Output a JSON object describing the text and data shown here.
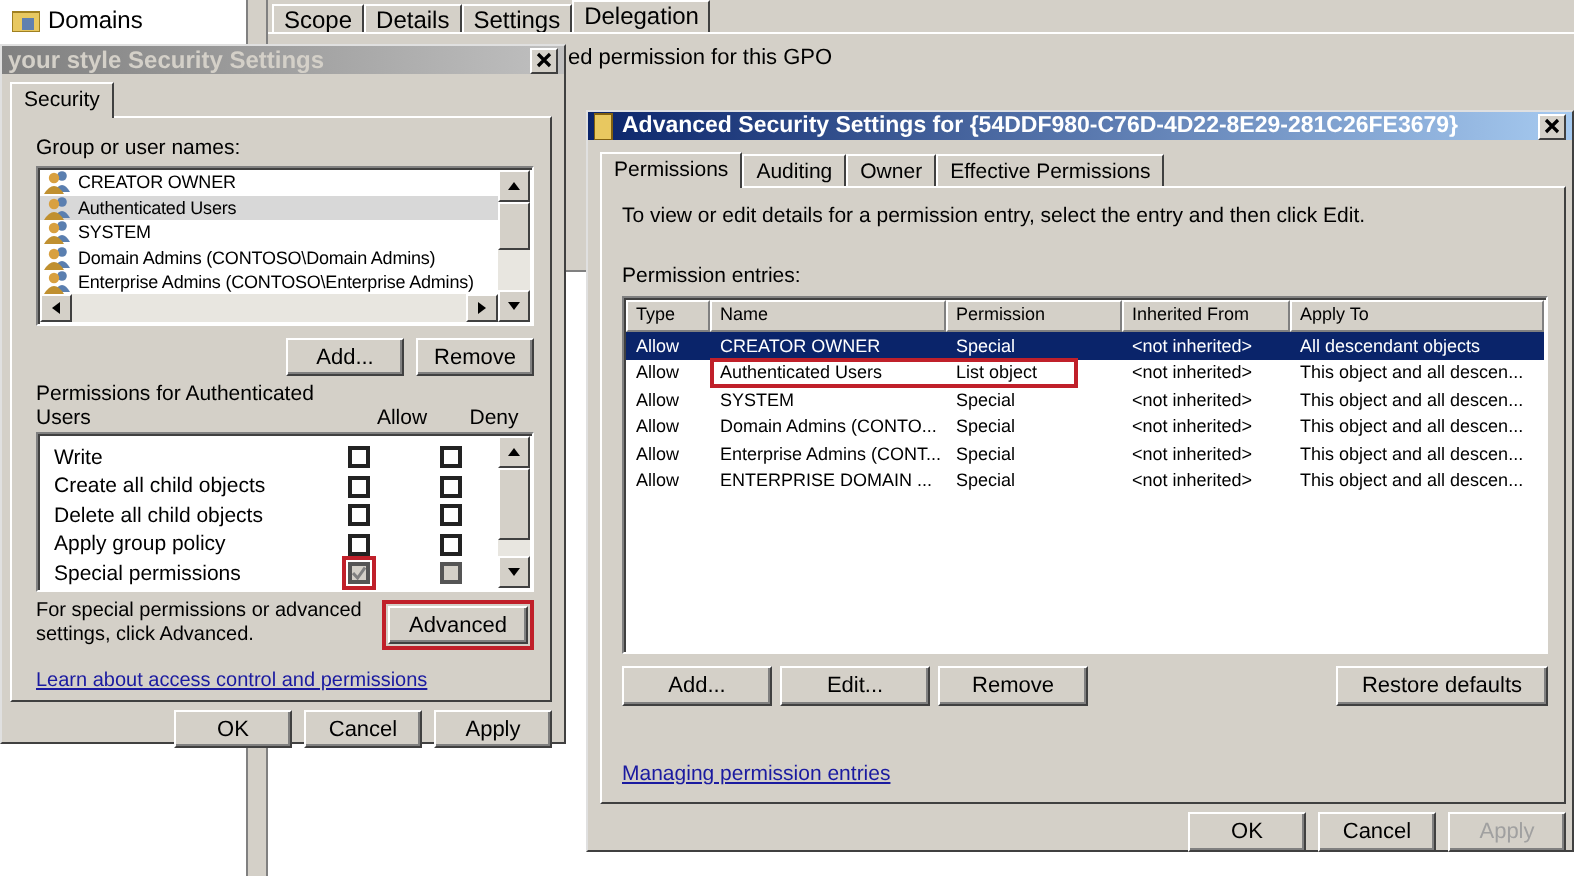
{
  "console": {
    "tree_items": [
      {
        "label": "Domains"
      }
    ],
    "tabs": [
      {
        "label": "Scope",
        "selected": false
      },
      {
        "label": "Details",
        "selected": false
      },
      {
        "label": "Settings",
        "selected": false
      },
      {
        "label": "Delegation",
        "selected": true
      }
    ],
    "description": "ed permission for this GPO"
  },
  "security_dialog": {
    "title": "your style Security Settings",
    "active": false,
    "tabs": [
      {
        "label": "Security",
        "selected": true
      }
    ],
    "groups_label": "Group or user names:",
    "groups": [
      {
        "name": "CREATOR OWNER",
        "selected": false
      },
      {
        "name": "Authenticated Users",
        "selected": true
      },
      {
        "name": "SYSTEM",
        "selected": false
      },
      {
        "name": "Domain Admins (CONTOSO\\Domain Admins)",
        "selected": false
      },
      {
        "name": "Enterprise Admins (CONTOSO\\Enterprise Admins)",
        "selected": false
      }
    ],
    "group_buttons": [
      "Add...",
      "Remove"
    ],
    "permissions_label": "Permissions for Authenticated Users",
    "columns": [
      "Allow",
      "Deny"
    ],
    "permissions": [
      {
        "name": "Write",
        "allow": false,
        "deny": false,
        "disabled": false,
        "highlighted": false
      },
      {
        "name": "Create all child objects",
        "allow": false,
        "deny": false,
        "disabled": false,
        "highlighted": false
      },
      {
        "name": "Delete all child objects",
        "allow": false,
        "deny": false,
        "disabled": false,
        "highlighted": false
      },
      {
        "name": "Apply group policy",
        "allow": false,
        "deny": false,
        "disabled": false,
        "highlighted": false
      },
      {
        "name": "Special permissions",
        "allow": true,
        "deny": false,
        "disabled": true,
        "highlighted": true
      }
    ],
    "advanced_hint": "For special permissions or advanced settings, click Advanced.",
    "advanced_button": {
      "label": "Advanced",
      "highlighted": true
    },
    "link": "Learn about access control and permissions",
    "buttons": [
      {
        "label": "OK",
        "disabled": false
      },
      {
        "label": "Cancel",
        "disabled": false
      },
      {
        "label": "Apply",
        "disabled": false
      }
    ]
  },
  "advanced_dialog": {
    "title": "Advanced Security Settings for {54DDF980-C76D-4D22-8E29-281C26FE3679}",
    "active": true,
    "tabs": [
      {
        "label": "Permissions",
        "selected": true
      },
      {
        "label": "Auditing",
        "selected": false
      },
      {
        "label": "Owner",
        "selected": false
      },
      {
        "label": "Effective Permissions",
        "selected": false
      }
    ],
    "instruction": "To view or edit details for a permission entry, select the entry and then click Edit.",
    "entries_label": "Permission entries:",
    "columns": [
      "Type",
      "Name",
      "Permission",
      "Inherited From",
      "Apply To"
    ],
    "entries": [
      {
        "type": "Allow",
        "name": "CREATOR OWNER",
        "permission": "Special",
        "inherited_from": "<not inherited>",
        "apply_to": "All descendant objects",
        "selected": true,
        "highlighted": false
      },
      {
        "type": "Allow",
        "name": "Authenticated Users",
        "permission": "List object",
        "inherited_from": "<not inherited>",
        "apply_to": "This object and all descen...",
        "selected": false,
        "highlighted": true
      },
      {
        "type": "Allow",
        "name": "SYSTEM",
        "permission": "Special",
        "inherited_from": "<not inherited>",
        "apply_to": "This object and all descen...",
        "selected": false,
        "highlighted": false
      },
      {
        "type": "Allow",
        "name": "Domain Admins (CONTO...",
        "permission": "Special",
        "inherited_from": "<not inherited>",
        "apply_to": "This object and all descen...",
        "selected": false,
        "highlighted": false
      },
      {
        "type": "Allow",
        "name": "Enterprise Admins (CONT...",
        "permission": "Special",
        "inherited_from": "<not inherited>",
        "apply_to": "This object and all descen...",
        "selected": false,
        "highlighted": false
      },
      {
        "type": "Allow",
        "name": "ENTERPRISE DOMAIN ...",
        "permission": "Special",
        "inherited_from": "<not inherited>",
        "apply_to": "This object and all descen...",
        "selected": false,
        "highlighted": false
      }
    ],
    "entry_buttons": [
      "Add...",
      "Edit...",
      "Remove"
    ],
    "restore_button": "Restore defaults",
    "link": "Managing permission entries",
    "buttons": [
      {
        "label": "OK",
        "disabled": false
      },
      {
        "label": "Cancel",
        "disabled": false
      },
      {
        "label": "Apply",
        "disabled": true
      }
    ]
  }
}
